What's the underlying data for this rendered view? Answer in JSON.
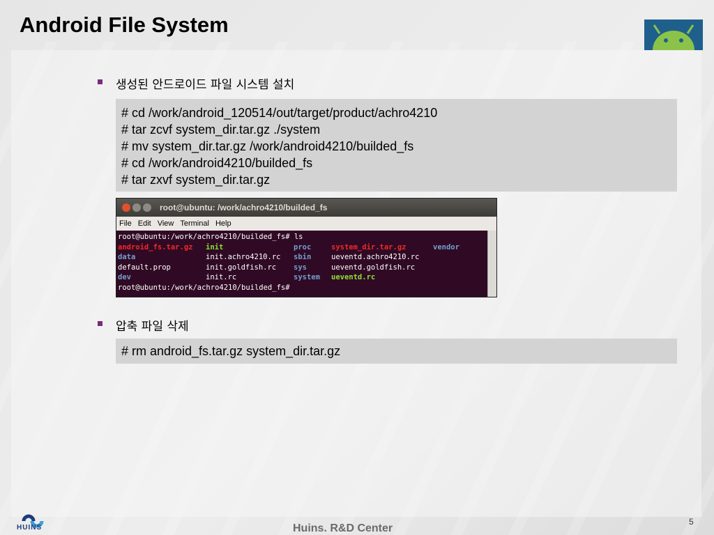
{
  "title": "Android File System",
  "bullets": [
    {
      "text": "생성된 안드로이드 파일 시스템 설치"
    },
    {
      "text": "압축 파일 삭제"
    }
  ],
  "code1": [
    "# cd /work/android_120514/out/target/product/achro4210",
    "# tar zcvf system_dir.tar.gz ./system",
    "# mv system_dir.tar.gz /work/android4210/builded_fs",
    "# cd /work/android4210/builded_fs",
    "# tar zxvf system_dir.tar.gz"
  ],
  "code2": [
    "# rm android_fs.tar.gz system_dir.tar.gz"
  ],
  "terminal": {
    "window_title": "root@ubuntu: /work/achro4210/builded_fs",
    "menu": [
      "File",
      "Edit",
      "View",
      "Terminal",
      "Help"
    ],
    "prompt1": "root@ubuntu:/work/achro4210/builded_fs# ls",
    "rows": [
      [
        {
          "t": "android_fs.tar.gz",
          "c": "#ef2929"
        },
        {
          "t": "init",
          "c": "#8ae234"
        },
        {
          "t": "proc",
          "c": "#729fcf"
        },
        {
          "t": "system_dir.tar.gz",
          "c": "#ef2929"
        },
        {
          "t": "vendor",
          "c": "#729fcf"
        }
      ],
      [
        {
          "t": "data",
          "c": "#729fcf"
        },
        {
          "t": "init.achro4210.rc",
          "c": "#ffffff"
        },
        {
          "t": "sbin",
          "c": "#729fcf"
        },
        {
          "t": "ueventd.achro4210.rc",
          "c": "#ffffff"
        },
        {
          "t": "",
          "c": "#ffffff"
        }
      ],
      [
        {
          "t": "default.prop",
          "c": "#ffffff"
        },
        {
          "t": "init.goldfish.rc",
          "c": "#ffffff"
        },
        {
          "t": "sys",
          "c": "#729fcf"
        },
        {
          "t": "ueventd.goldfish.rc",
          "c": "#ffffff"
        },
        {
          "t": "",
          "c": "#ffffff"
        }
      ],
      [
        {
          "t": "dev",
          "c": "#729fcf"
        },
        {
          "t": "init.rc",
          "c": "#ffffff"
        },
        {
          "t": "system",
          "c": "#729fcf"
        },
        {
          "t": "ueventd.rc",
          "c": "#8ae234"
        },
        {
          "t": "",
          "c": "#ffffff"
        }
      ]
    ],
    "prompt2": "root@ubuntu:/work/achro4210/builded_fs#"
  },
  "footer": "Huins. R&D Center",
  "page_number": "5",
  "logo_text": "HUINS"
}
